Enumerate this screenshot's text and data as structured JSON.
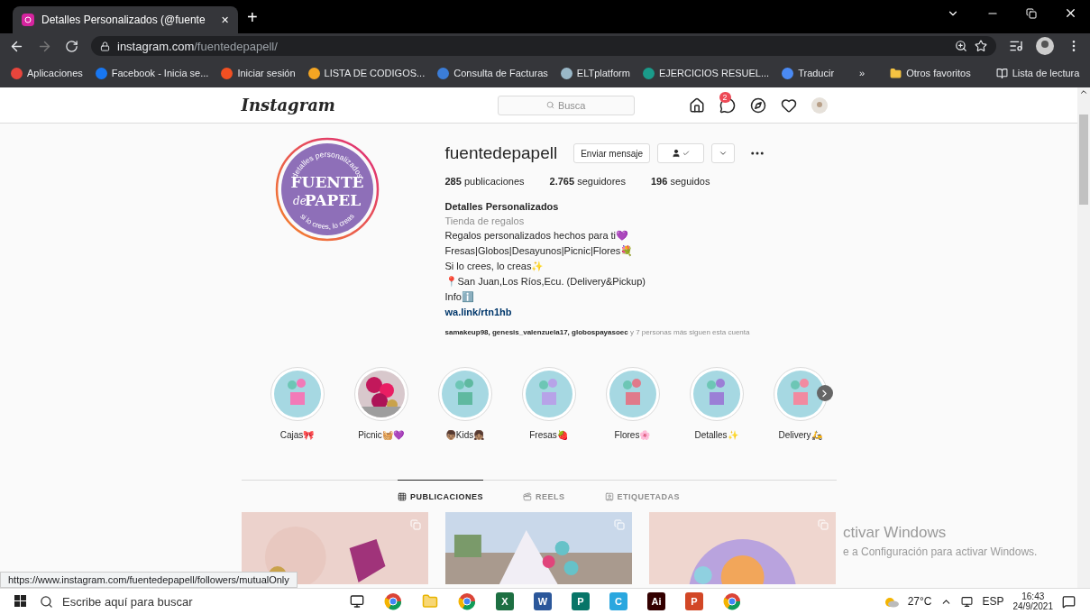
{
  "browser": {
    "tab": {
      "title": "Detalles Personalizados (@fuente",
      "close": "✕",
      "new_tab": "+"
    },
    "url": {
      "host": "instagram.com",
      "path": "/fuentedepapell/"
    },
    "bookmarks": [
      {
        "label": "Aplicaciones",
        "color": "#e8453c"
      },
      {
        "label": "Facebook - Inicia se...",
        "color": "#1877f2"
      },
      {
        "label": "Iniciar sesión",
        "color": "#f25022"
      },
      {
        "label": "LISTA DE CODIGOS...",
        "color": "#f5a623"
      },
      {
        "label": "Consulta de Facturas",
        "color": "#3b7dd8"
      },
      {
        "label": "ELTplatform",
        "color": "#9ab8c8"
      },
      {
        "label": "EJERCICIOS RESUEL...",
        "color": "#1a9b8a"
      },
      {
        "label": "Traducir",
        "color": "#4a8af4"
      }
    ],
    "more": "»",
    "other_bookmarks": "Otros favoritos",
    "reading_list": "Lista de lectura"
  },
  "instagram": {
    "logo": "Instagram",
    "search": {
      "placeholder": "Busca"
    },
    "messages_badge": "2",
    "profile": {
      "username": "fuentedepapell",
      "message_button": "Enviar mensaje",
      "avatar": {
        "top": "detalles personalizados",
        "line1": "FUENTE",
        "script": "de",
        "line2": "PAPEL",
        "bottom": "si lo crees, lo creas"
      },
      "stats": [
        {
          "count": "285",
          "label": "publicaciones"
        },
        {
          "count": "2.765",
          "label": "seguidores"
        },
        {
          "count": "196",
          "label": "seguidos"
        }
      ],
      "name": "Detalles Personalizados",
      "category": "Tienda de regalos",
      "bio": [
        "Regalos personalizados hechos para ti💜",
        "Fresas|Globos|Desayunos|Picnic|Flores💐",
        "Si lo crees, lo creas✨",
        "📍San Juan,Los Ríos,Ecu. (Delivery&Pickup)",
        "Infoℹ️"
      ],
      "link": "wa.link/rtn1hb",
      "followed_by": {
        "names": "samakeup98, genesis_valenzuela17, globospayasoec",
        "rest": "y 7 personas más siguen esta cuenta"
      }
    },
    "highlights": [
      {
        "label": "Cajas🎀",
        "kind": "illustration"
      },
      {
        "label": "Picnic🧺💜",
        "kind": "picture"
      },
      {
        "label": "👦🏽Kids👧🏽",
        "kind": "illustration"
      },
      {
        "label": "Fresas🍓",
        "kind": "illustration"
      },
      {
        "label": "Flores🌸",
        "kind": "illustration"
      },
      {
        "label": "Detalles✨",
        "kind": "illustration"
      },
      {
        "label": "Delivery🛵",
        "kind": "illustration"
      }
    ],
    "tabs": [
      {
        "label": "PUBLICACIONES",
        "selected": true
      },
      {
        "label": "REELS",
        "selected": false
      },
      {
        "label": "ETIQUETADAS",
        "selected": false
      }
    ]
  },
  "windows_notice": {
    "title": "ctivar Windows",
    "text": "e a Configuración para activar Windows."
  },
  "status_link": "https://www.instagram.com/fuentedepapell/followers/mutualOnly",
  "taskbar": {
    "search": {
      "placeholder": "Escribe aquí para buscar"
    },
    "apps": [
      {
        "kind": "taskview"
      },
      {
        "kind": "chrome"
      },
      {
        "kind": "folder"
      },
      {
        "kind": "chrome"
      },
      {
        "kind": "letter",
        "text": "X",
        "color": "#1d6f42"
      },
      {
        "kind": "letter",
        "text": "W",
        "color": "#2b579a"
      },
      {
        "kind": "letter",
        "text": "P",
        "color": "#077568"
      },
      {
        "kind": "letter",
        "text": "C",
        "color": "#2aa7df"
      },
      {
        "kind": "letter",
        "text": "Ai",
        "color": "#330000"
      },
      {
        "kind": "letter",
        "text": "P",
        "color": "#d24726"
      },
      {
        "kind": "chrome"
      }
    ],
    "temperature": "27°C",
    "language": "ESP",
    "time": "16:43",
    "date": "24/9/2021"
  }
}
